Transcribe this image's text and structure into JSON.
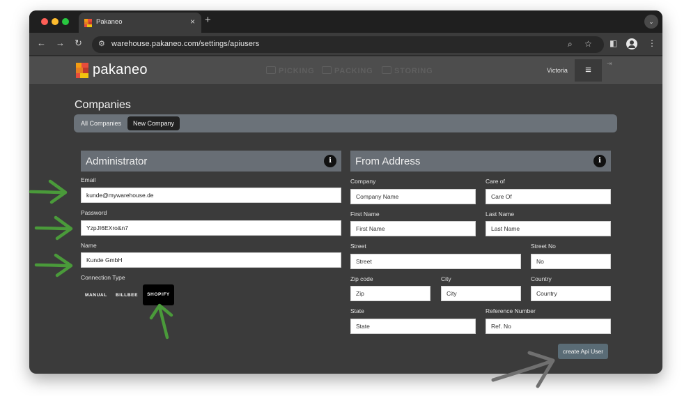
{
  "browser": {
    "tab_title": "Pakaneo",
    "tab_close": "×",
    "new_tab": "+",
    "tab_list": "⌄",
    "url": "warehouse.pakaneo.com/settings/apiusers",
    "nav": {
      "back": "←",
      "forward": "→",
      "reload": "↻",
      "site_settings": "⚙"
    },
    "icons": {
      "zoom": "⌕",
      "bookmark": "☆",
      "side_panel": "◧",
      "menu": "⋮"
    }
  },
  "app": {
    "logo_text": "pakaneo",
    "nav": [
      "PICKING",
      "PACKING",
      "STORING"
    ],
    "user_name": "Victoria",
    "menu_icon": "≡",
    "logout_icon": "⇥"
  },
  "page": {
    "title": "Companies",
    "tabs": [
      {
        "label": "All Companies",
        "active": false
      },
      {
        "label": "New Company",
        "active": true
      }
    ]
  },
  "administrator": {
    "title": "Administrator",
    "info": "i",
    "email": {
      "label": "Email",
      "value": "kunde@mywarehouse.de"
    },
    "password": {
      "label": "Password",
      "value": "YzpJI6EXro&n7"
    },
    "name": {
      "label": "Name",
      "value": "Kunde GmbH"
    },
    "connection_type": {
      "label": "Connection Type",
      "options": [
        "MANUAL",
        "BILLBEE",
        "SHOPIFY"
      ],
      "selected": "SHOPIFY"
    }
  },
  "from_address": {
    "title": "From Address",
    "info": "i",
    "company": {
      "label": "Company",
      "placeholder": "Company Name"
    },
    "care_of": {
      "label": "Care of",
      "placeholder": "Care Of"
    },
    "first_name": {
      "label": "First Name",
      "placeholder": "First Name"
    },
    "last_name": {
      "label": "Last Name",
      "placeholder": "Last Name"
    },
    "street": {
      "label": "Street",
      "placeholder": "Street"
    },
    "street_no": {
      "label": "Street No",
      "placeholder": "No"
    },
    "zip": {
      "label": "Zip code",
      "placeholder": "Zip"
    },
    "city": {
      "label": "City",
      "placeholder": "City"
    },
    "country": {
      "label": "Country",
      "placeholder": "Country"
    },
    "state": {
      "label": "State",
      "placeholder": "State"
    },
    "reference": {
      "label": "Reference Number",
      "placeholder": "Ref. No"
    }
  },
  "actions": {
    "create_label": "create Api User"
  },
  "colors": {
    "app_background": "#3b3b3b",
    "panel_header": "#686e75",
    "tab_bar": "#6b7279",
    "create_button": "#5a6c76",
    "annotation_green": "#4a9a3a",
    "annotation_gray": "#707070"
  }
}
